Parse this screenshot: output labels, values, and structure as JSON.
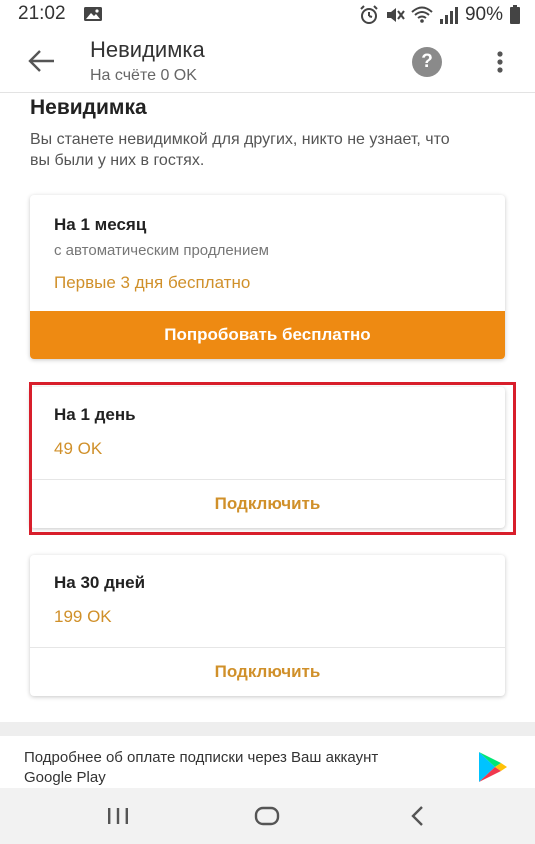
{
  "status_bar": {
    "time": "21:02",
    "battery": "90%",
    "icons": [
      "image-icon",
      "alarm-icon",
      "mute-icon",
      "wifi-icon",
      "signal-icon",
      "battery-icon"
    ]
  },
  "app_bar": {
    "title": "Невидимка",
    "subtitle": "На счёте 0 OK",
    "help_label": "?"
  },
  "section": {
    "title": "Невидимка",
    "description": "Вы станете невидимкой для других, никто не узнает, что вы были у них в гостях."
  },
  "plans": [
    {
      "title": "На 1 месяц",
      "subtitle": "с автоматическим продлением",
      "accent": "Первые 3 дня бесплатно",
      "action": "Попробовать бесплатно"
    },
    {
      "title": "На 1 день",
      "price": "49 OK",
      "action": "Подключить"
    },
    {
      "title": "На 30 дней",
      "price": "199 OK",
      "action": "Подключить"
    }
  ],
  "footer": {
    "text": "Подробнее об оплате подписки через Ваш аккаунт Google Play"
  },
  "colors": {
    "accent_orange": "#ee8a12",
    "accent_text": "#d0902a",
    "highlight_red": "#d81e2b"
  }
}
